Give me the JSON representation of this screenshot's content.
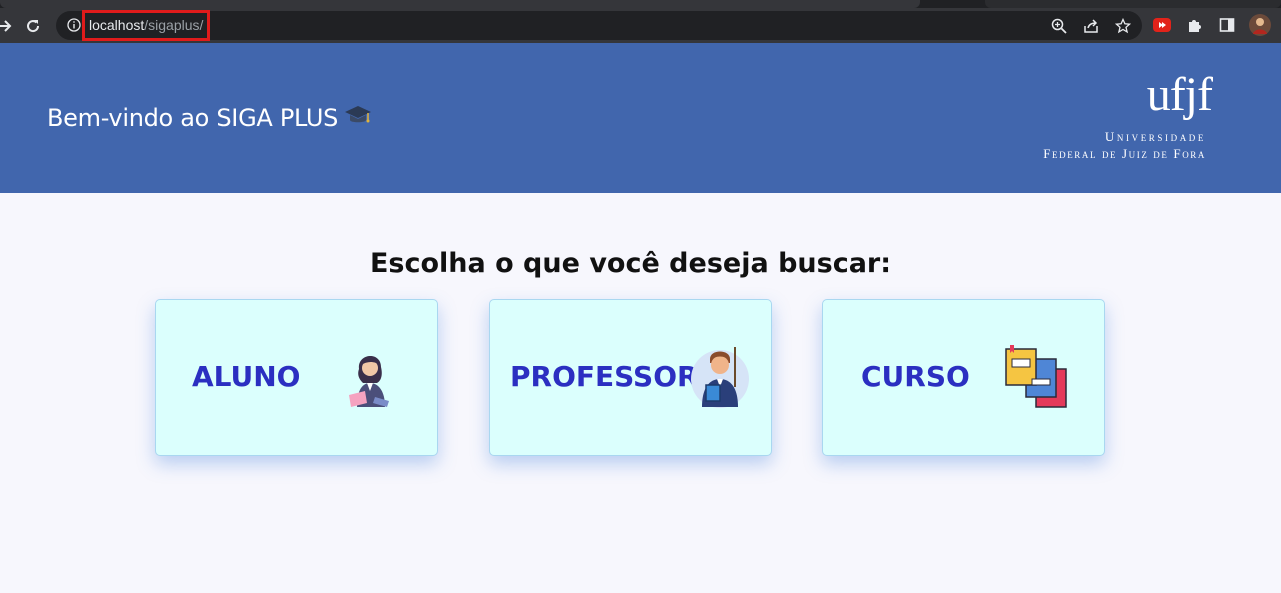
{
  "browser": {
    "url_host": "localhost",
    "url_path": "/sigaplus/",
    "icons": {
      "back": "back-arrow-icon",
      "reload": "reload-icon",
      "info": "info-icon",
      "zoom": "zoom-icon",
      "share": "share-icon",
      "bookmark": "star-icon",
      "extension_red": "youtube-extension-icon",
      "extensions": "puzzle-icon",
      "sidepanel": "side-panel-icon",
      "profile": "profile-avatar"
    },
    "highlight_color": "#e01b1b"
  },
  "header": {
    "welcome": "Bem-vindo ao SIGA PLUS",
    "welcome_icon": "graduation-cap-icon",
    "logo": {
      "mark": "ufjf",
      "line1": "Universidade",
      "line2": "Federal de Juiz de Fora"
    },
    "background": "#4166ad"
  },
  "main": {
    "prompt": "Escolha o que você deseja buscar:",
    "cards": [
      {
        "label": "ALUNO",
        "icon": "student-icon"
      },
      {
        "label": "PROFESSOR",
        "icon": "teacher-icon"
      },
      {
        "label": "CURSO",
        "icon": "books-icon"
      }
    ],
    "card_background": "#dbfffd",
    "label_color": "#2b2fc1"
  }
}
